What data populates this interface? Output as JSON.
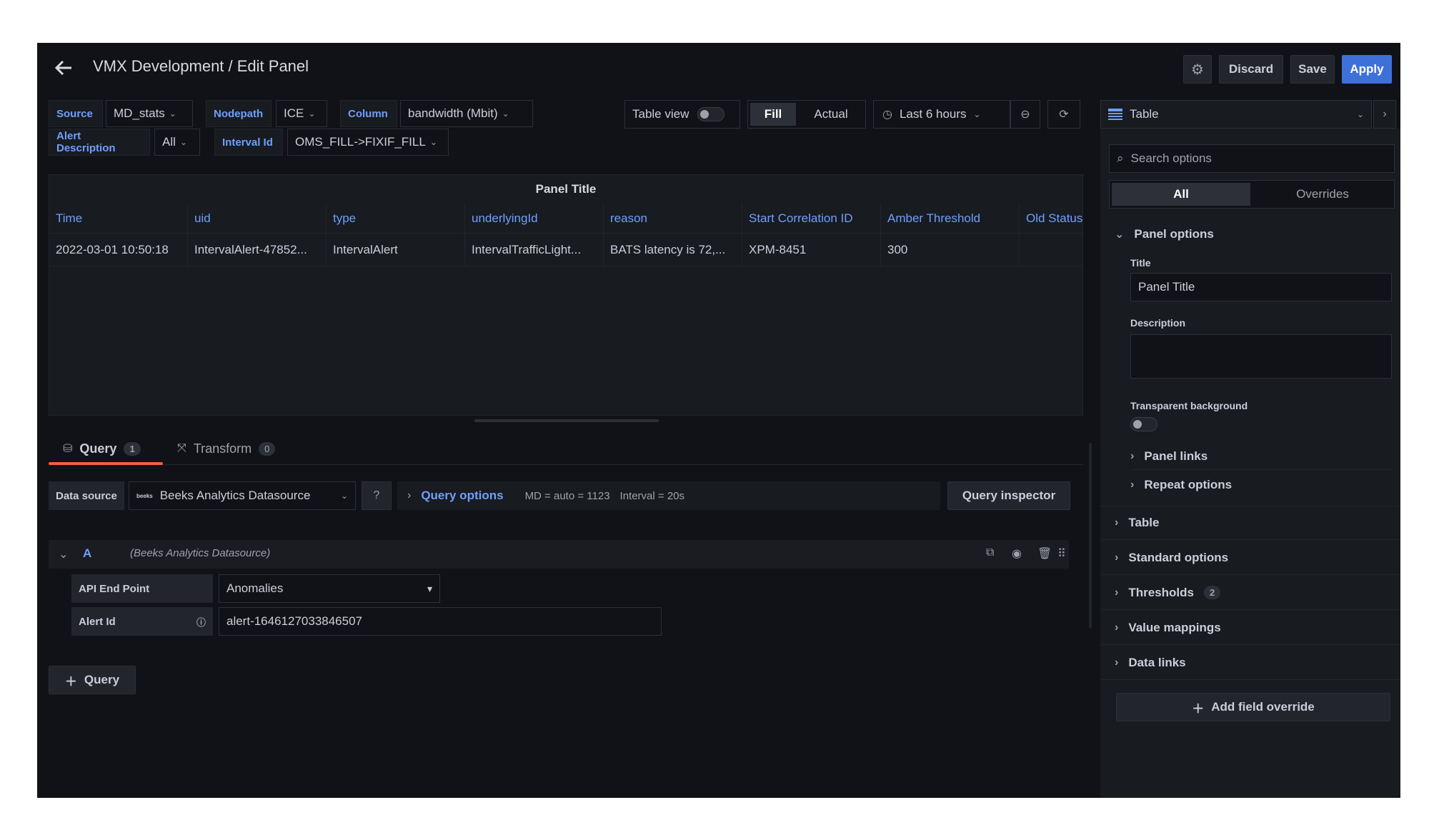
{
  "header": {
    "title": "VMX Development / Edit Panel",
    "discard": "Discard",
    "save": "Save",
    "apply": "Apply"
  },
  "variables": {
    "source_label": "Source",
    "source_value": "MD_stats",
    "nodepath_label": "Nodepath",
    "nodepath_value": "ICE",
    "column_label": "Column",
    "column_value": "bandwidth (Mbit)",
    "alertdesc_label": "Alert Description",
    "alertdesc_value": "All",
    "intervalid_label": "Interval Id",
    "intervalid_value": "OMS_FILL->FIXIF_FILL"
  },
  "toolbar": {
    "table_view": "Table view",
    "fill": "Fill",
    "actual": "Actual",
    "time_range": "Last 6 hours"
  },
  "viz_picker": {
    "label": "Table"
  },
  "panel": {
    "title": "Panel Title",
    "columns": [
      "Time",
      "uid",
      "type",
      "underlyingId",
      "reason",
      "Start Correlation ID",
      "Amber Threshold",
      "Old Status"
    ],
    "rows": [
      [
        "2022-03-01 10:50:18",
        "IntervalAlert-47852...",
        "IntervalAlert",
        "IntervalTrafficLight...",
        "BATS latency is 72,...",
        "XPM-8451",
        "300",
        ""
      ]
    ]
  },
  "editor_tabs": {
    "query_label": "Query",
    "query_count": "1",
    "transform_label": "Transform",
    "transform_count": "0"
  },
  "query_bar": {
    "datasource_label": "Data source",
    "datasource_icon_text": "beeks",
    "datasource_value": "Beeks Analytics Datasource",
    "query_options": "Query options",
    "md_info": "MD = auto = 1123",
    "interval_info": "Interval = 20s",
    "inspector": "Query inspector"
  },
  "query_a": {
    "ref": "A",
    "datasource_note": "(Beeks Analytics Datasource)",
    "api_label": "API End Point",
    "api_value": "Anomalies",
    "alert_label": "Alert Id",
    "alert_value": "alert-1646127033846507"
  },
  "add_query": "Query",
  "options": {
    "search_placeholder": "Search options",
    "tab_all": "All",
    "tab_overrides": "Overrides",
    "panel_options": "Panel options",
    "title_label": "Title",
    "title_value": "Panel Title",
    "description_label": "Description",
    "transparent_label": "Transparent background",
    "panel_links": "Panel links",
    "repeat_options": "Repeat options",
    "sections": {
      "table": "Table",
      "standard": "Standard options",
      "thresholds": "Thresholds",
      "thresholds_count": "2",
      "value_mappings": "Value mappings",
      "data_links": "Data links"
    },
    "add_override": "Add field override"
  }
}
